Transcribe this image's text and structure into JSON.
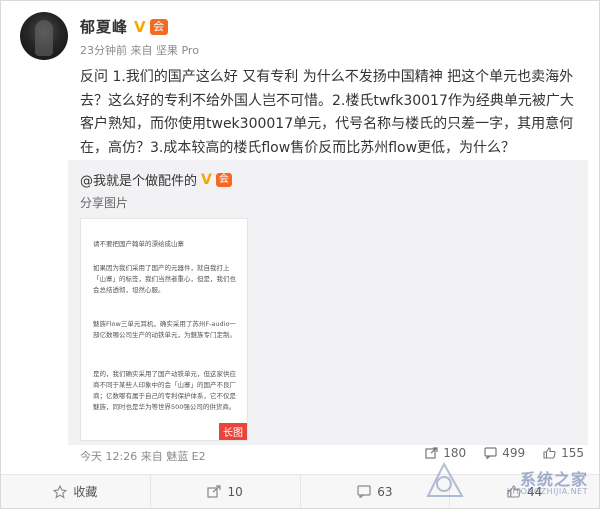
{
  "post": {
    "author": "郁夏峰",
    "verified_badge": "V",
    "member_badge": "会",
    "meta": "23分钟前 来自 坚果 Pro",
    "text": "反问 1.我们的国产这么好 又有专利 为什么不发扬中国精神 把这个单元也卖海外去？这么好的专利不给外国人岂不可惜。2.楼氏twfk30017作为经典单元被广大客户熟知，而你使用twek300017单元，代号名称与楼氏的只差一字，其用意何在，高仿？3.成本较高的楼氏flow售价反而比苏州flow更低，为什么？"
  },
  "repost": {
    "at_user": "@我就是个做配件的",
    "verified_badge": "V",
    "member_badge": "会",
    "share_label": "分享图片",
    "image_tag": "长图",
    "image_lines": [
      "请不要把国产翰单的漂给成山寨",
      "如果因为我们采用了国产的元器件，就自我打上「山寨」的标签，我们当然者重心，但是，我们也会总结透彻，坦然心服。",
      "魅族Flow三单元耳机，确实采用了苏州F-audio一部亿数哪公司生产的动铁单元，为魅族专门定制。",
      "是的，我们确实采用了国产动铁单元，但这家供应商不同于某些人印象中的会「山寨」的国产不良厂商；亿数哪有属于自己的专利保护体系，它不仅是魅族，同时也是华为等世界500强公司的供货商。"
    ]
  },
  "footer": {
    "meta": "今天 12:26 来自 魅蓝 E2",
    "share_count": "180",
    "comment_count": "499",
    "like_count": "155"
  },
  "actions": {
    "favorite": "收藏",
    "forward": "10",
    "comment": "63",
    "like": "44"
  },
  "watermark": {
    "text": "系统之家",
    "sub": "XITONGZHIJIA.NET"
  },
  "colors": {
    "verified": "#f7a700",
    "member": "#f46a23",
    "image_tag": "#e9453a"
  }
}
